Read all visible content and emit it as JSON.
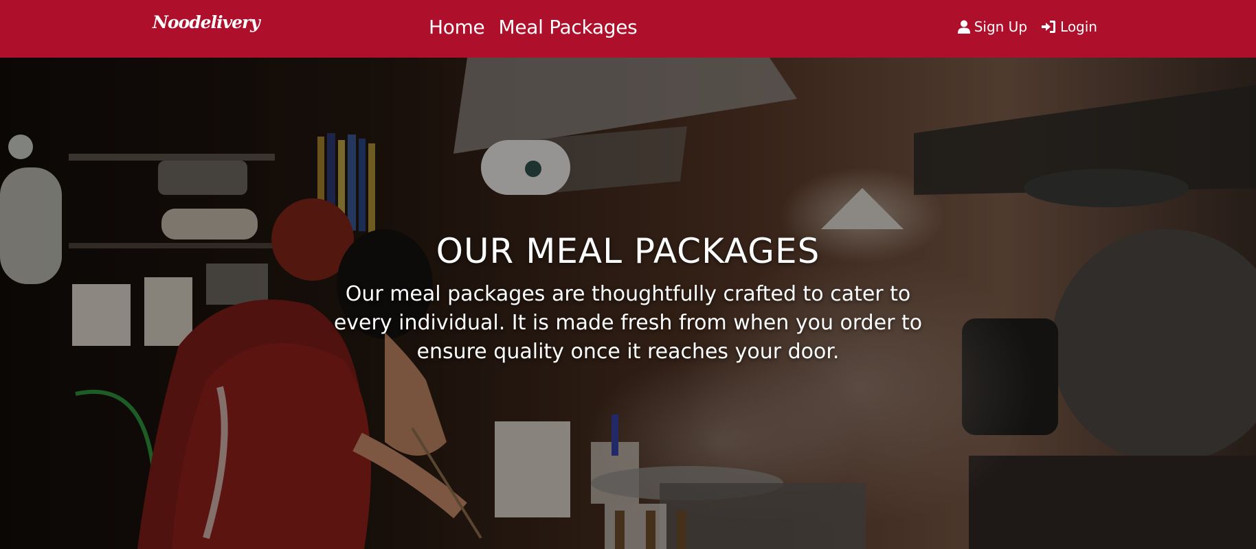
{
  "nav": {
    "brand": "Noodelivery",
    "links": [
      {
        "label": "Home"
      },
      {
        "label": "Meal Packages"
      }
    ],
    "auth": {
      "signup_label": "Sign Up",
      "signup_icon": "user-icon",
      "login_label": "Login",
      "login_icon": "sign-in-icon"
    }
  },
  "hero": {
    "title": "OUR MEAL PACKAGES",
    "subtitle": "Our meal packages are thoughtfully crafted to cater to every individual. It is made fresh from when you order to ensure quality once it reaches your door."
  },
  "colors": {
    "navbar_bg": "#ae102c",
    "text": "#ffffff"
  }
}
